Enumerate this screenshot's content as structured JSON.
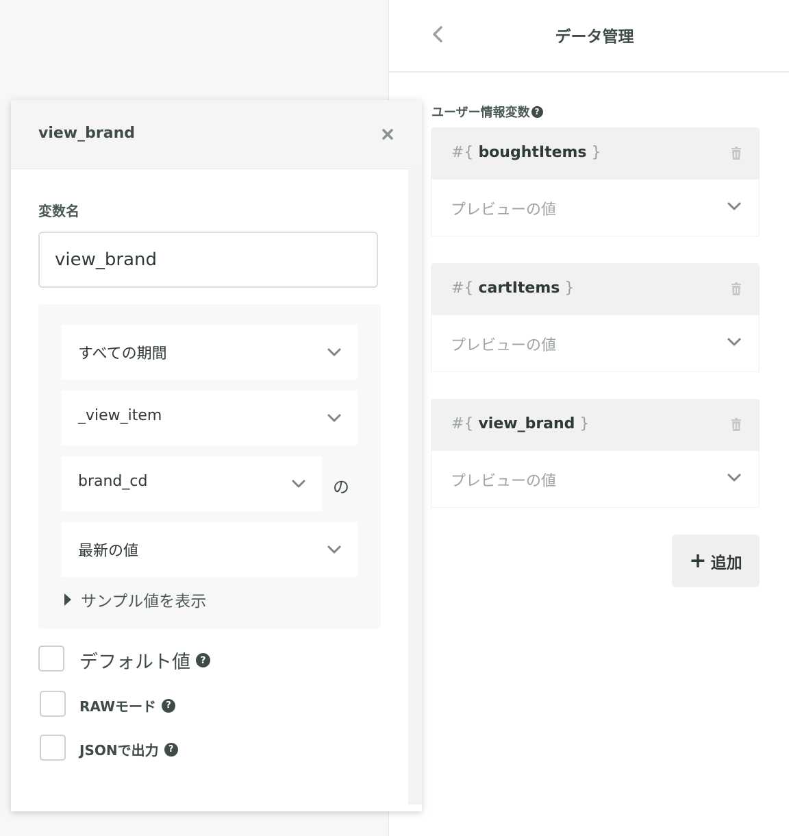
{
  "header": {
    "title": "データ管理"
  },
  "section": {
    "label": "ユーザー情報変数"
  },
  "variables": [
    {
      "prefix": "#{",
      "name": "boughtItems",
      "suffix": "}",
      "preview": "プレビューの値"
    },
    {
      "prefix": "#{",
      "name": "cartItems",
      "suffix": "}",
      "preview": "プレビューの値"
    },
    {
      "prefix": "#{",
      "name": "view_brand",
      "suffix": "}",
      "preview": "プレビューの値"
    }
  ],
  "add_button": {
    "icon": "+",
    "label": "追加"
  },
  "modal": {
    "title": "view_brand",
    "close": "×",
    "field_label": "変数名",
    "name_value": "view_brand",
    "selects": {
      "period": "すべての期間",
      "event": "_view_item",
      "property": "brand_cd",
      "property_suffix": "の",
      "aggregation": "最新の値"
    },
    "sample_toggle": "サンプル値を表示",
    "options": {
      "default_value": "デフォルト値",
      "raw_mode": "RAWモード",
      "json_output": "JSONで出力"
    },
    "help": "?"
  }
}
